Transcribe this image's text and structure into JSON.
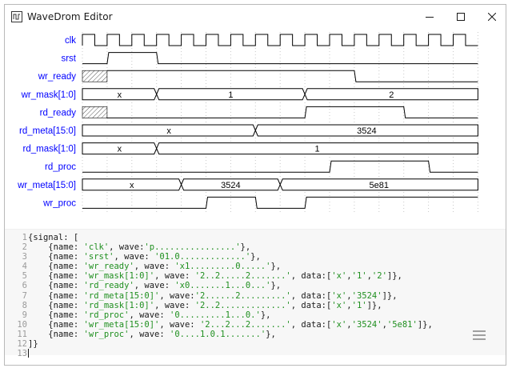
{
  "window": {
    "title": "WaveDrom Editor",
    "controls": [
      "minimize",
      "maximize",
      "close"
    ]
  },
  "icons": {
    "app": "wavedrom-app-icon",
    "minimize": "minimize-icon",
    "maximize": "maximize-icon",
    "close": "close-icon",
    "editor_menu": "hamburger-menu-icon"
  },
  "colors": {
    "signal_label": "#0000ff",
    "wave": "#000000",
    "grid": "#c8c8c8",
    "string": "#1f8f1f",
    "gutter": "#9a9a9a",
    "editor_bg": "#f7f7f7"
  },
  "waveform": {
    "signals": [
      {
        "name": "clk",
        "wave": "p................",
        "kind": "clock"
      },
      {
        "name": "srst",
        "wave": "01.0............."
      },
      {
        "name": "wr_ready",
        "wave": "x1.........0....."
      },
      {
        "name": "wr_mask[1:0]",
        "wave": "2..2.....2.......",
        "data": [
          "x",
          "1",
          "2"
        ]
      },
      {
        "name": "rd_ready",
        "wave": "x0.......1...0..."
      },
      {
        "name": "rd_meta[15:0]",
        "wave": "2......2.........",
        "data": [
          "x",
          "3524"
        ]
      },
      {
        "name": "rd_mask[1:0]",
        "wave": "2..2.............",
        "data": [
          "x",
          "1"
        ]
      },
      {
        "name": "rd_proc",
        "wave": "0.........1...0."
      },
      {
        "name": "wr_meta[15:0]",
        "wave": "2...2...2.......",
        "data": [
          "x",
          "3524",
          "5e81"
        ]
      },
      {
        "name": "wr_proc",
        "wave": "0....1.0.1......."
      }
    ]
  },
  "editor": {
    "line_numbers": [
      "1",
      "2",
      "3",
      "4",
      "5",
      "6",
      "7",
      "8",
      "9",
      "10",
      "11",
      "12",
      "13"
    ],
    "lines": [
      [
        {
          "t": "br",
          "v": "{signal: ["
        }
      ],
      [
        {
          "t": "br",
          "v": "    {name: "
        },
        {
          "t": "str",
          "v": "'clk'"
        },
        {
          "t": "br",
          "v": ", wave:"
        },
        {
          "t": "str",
          "v": "'p................'"
        },
        {
          "t": "br",
          "v": "},"
        }
      ],
      [
        {
          "t": "br",
          "v": "    {name: "
        },
        {
          "t": "str",
          "v": "'srst'"
        },
        {
          "t": "br",
          "v": ", wave: "
        },
        {
          "t": "str",
          "v": "'01.0.............'"
        },
        {
          "t": "br",
          "v": "},"
        }
      ],
      [
        {
          "t": "br",
          "v": "    {name: "
        },
        {
          "t": "str",
          "v": "'wr_ready'"
        },
        {
          "t": "br",
          "v": ", wave: "
        },
        {
          "t": "str",
          "v": "'x1.........0.....'"
        },
        {
          "t": "br",
          "v": "},"
        }
      ],
      [
        {
          "t": "br",
          "v": "    {name: "
        },
        {
          "t": "str",
          "v": "'wr_mask[1:0]'"
        },
        {
          "t": "br",
          "v": ", wave: "
        },
        {
          "t": "str",
          "v": "'2..2.....2.......'"
        },
        {
          "t": "br",
          "v": ", data:["
        },
        {
          "t": "str",
          "v": "'x'"
        },
        {
          "t": "br",
          "v": ","
        },
        {
          "t": "str",
          "v": "'1'"
        },
        {
          "t": "br",
          "v": ","
        },
        {
          "t": "str",
          "v": "'2'"
        },
        {
          "t": "br",
          "v": "]},"
        }
      ],
      [
        {
          "t": "br",
          "v": "    {name: "
        },
        {
          "t": "str",
          "v": "'rd_ready'"
        },
        {
          "t": "br",
          "v": ", wave: "
        },
        {
          "t": "str",
          "v": "'x0.......1...0...'"
        },
        {
          "t": "br",
          "v": "},"
        }
      ],
      [
        {
          "t": "br",
          "v": "    {name: "
        },
        {
          "t": "str",
          "v": "'rd_meta[15:0]'"
        },
        {
          "t": "br",
          "v": ", wave:"
        },
        {
          "t": "str",
          "v": "'2......2.........'"
        },
        {
          "t": "br",
          "v": ", data:["
        },
        {
          "t": "str",
          "v": "'x'"
        },
        {
          "t": "br",
          "v": ","
        },
        {
          "t": "str",
          "v": "'3524'"
        },
        {
          "t": "br",
          "v": "]},"
        }
      ],
      [
        {
          "t": "br",
          "v": "    {name: "
        },
        {
          "t": "str",
          "v": "'rd_mask[1:0]'"
        },
        {
          "t": "br",
          "v": ", wave: "
        },
        {
          "t": "str",
          "v": "'2..2.............'"
        },
        {
          "t": "br",
          "v": ", data:["
        },
        {
          "t": "str",
          "v": "'x'"
        },
        {
          "t": "br",
          "v": ","
        },
        {
          "t": "str",
          "v": "'1'"
        },
        {
          "t": "br",
          "v": "]},"
        }
      ],
      [
        {
          "t": "br",
          "v": "    {name: "
        },
        {
          "t": "str",
          "v": "'rd_proc'"
        },
        {
          "t": "br",
          "v": ", wave: "
        },
        {
          "t": "str",
          "v": "'0.........1...0.'"
        },
        {
          "t": "br",
          "v": "},"
        }
      ],
      [
        {
          "t": "br",
          "v": "    {name: "
        },
        {
          "t": "str",
          "v": "'wr_meta[15:0]'"
        },
        {
          "t": "br",
          "v": ", wave: "
        },
        {
          "t": "str",
          "v": "'2...2...2.......'"
        },
        {
          "t": "br",
          "v": ", data:["
        },
        {
          "t": "str",
          "v": "'x'"
        },
        {
          "t": "br",
          "v": ","
        },
        {
          "t": "str",
          "v": "'3524'"
        },
        {
          "t": "br",
          "v": ","
        },
        {
          "t": "str",
          "v": "'5e81'"
        },
        {
          "t": "br",
          "v": "]},"
        }
      ],
      [
        {
          "t": "br",
          "v": "    {name: "
        },
        {
          "t": "str",
          "v": "'wr_proc'"
        },
        {
          "t": "br",
          "v": ", wave: "
        },
        {
          "t": "str",
          "v": "'0....1.0.1.......'"
        },
        {
          "t": "br",
          "v": "},"
        }
      ],
      [
        {
          "t": "br",
          "v": "]}"
        }
      ],
      []
    ]
  }
}
